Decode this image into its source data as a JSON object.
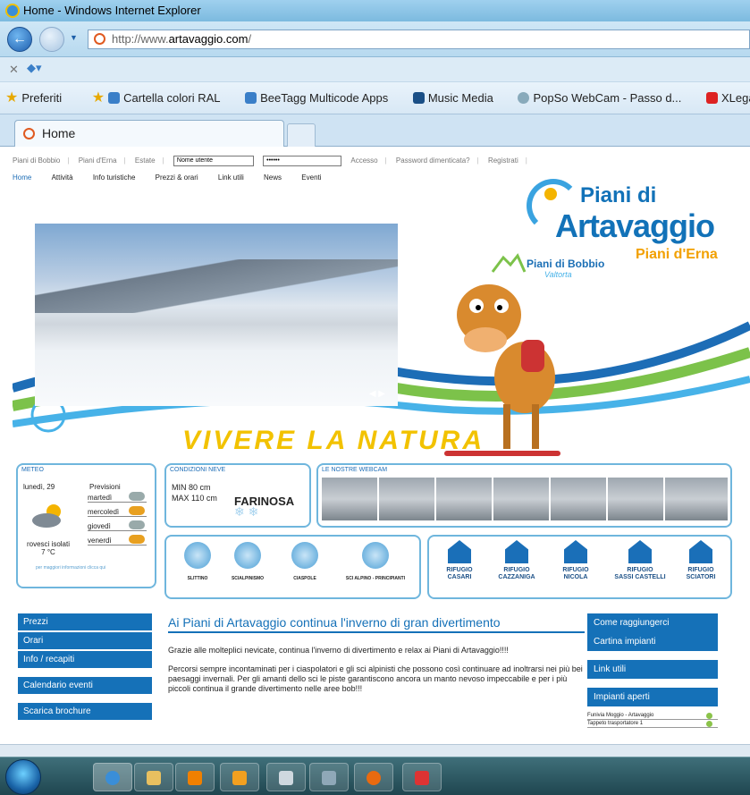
{
  "window": {
    "title": "Home - Windows Internet Explorer",
    "url_prefix": "http://www.",
    "url_domain": "artavaggio.com",
    "url_suffix": "/"
  },
  "favorites": [
    "Preferiti",
    "Cartella colori RAL",
    "BeeTagg Multicode Apps",
    "Music Media",
    "PopSo WebCam - Passo d...",
    "XLegalmail"
  ],
  "tab": {
    "title": "Home"
  },
  "site": {
    "topnav": [
      "Piani di Bobbio",
      "Piani d'Erna",
      "Estate"
    ],
    "login_user": "Nome utente",
    "login_pass": "••••••",
    "accesso": "Accesso",
    "password_forgot": "Password dimenticata?",
    "register": "Registrati",
    "mainnav": [
      "Home",
      "Attività",
      "Info turistiche",
      "Prezzi & orari",
      "Link utili",
      "News",
      "Eventi"
    ],
    "logo_line1": "Piani di",
    "logo_line2": "Artavaggio",
    "bobbio": "Piani di Bobbio",
    "bobbio_sub": "Valtorta",
    "erna": "Piani d'Erna",
    "slogan": "VIVERE LA NATURA",
    "meteo": {
      "title": "METEO",
      "today": "lunedì, 29",
      "prev": "Previsioni",
      "days": [
        "martedì",
        "mercoledì",
        "giovedì",
        "venerdì"
      ],
      "desc": "rovesci isolati",
      "temp": "7 °C",
      "link": "per maggiori informazioni clicca qui"
    },
    "neve": {
      "title": "CONDIZIONI NEVE",
      "min": "MIN 80 cm",
      "max": "MAX 110 cm",
      "type": "FARINOSA"
    },
    "webcam_title": "LE NOSTRE WEBCAM",
    "sports": [
      "SLITTINO",
      "SCIALPINISMO",
      "CIASPOLE",
      "SCI ALPINO - PRINCIPIANTI"
    ],
    "rifugi": [
      [
        "RIFUGIO",
        "CASARI"
      ],
      [
        "RIFUGIO",
        "CAZZANIGA"
      ],
      [
        "RIFUGIO",
        "NICOLA"
      ],
      [
        "RIFUGIO",
        "SASSI CASTELLI"
      ],
      [
        "RIFUGIO",
        "SCIATORI"
      ]
    ],
    "left": [
      "Prezzi",
      "Orari",
      "Info / recapiti",
      "Calendario eventi",
      "Scarica brochure"
    ],
    "article": {
      "title": "Ai Piani di Artavaggio continua l'inverno di gran divertimento",
      "p1": "Grazie alle molteplici nevicate, continua l'inverno di divertimento e relax ai Piani di Artavaggio!!!!",
      "p2": "Percorsi sempre incontaminati per i ciaspolatori e gli sci alpinisti che possono così continuare ad inoltrarsi nei più bei paesaggi invernali. Per gli amanti dello sci le piste garantiscono ancora un manto nevoso impeccabile e per i più piccoli continua il grande divertimento nelle aree bob!!!"
    },
    "right": [
      "Come raggiungerci",
      "Cartina impianti",
      "Link utili",
      "Impianti aperti"
    ],
    "impianti": [
      "Funivia Moggio - Artavaggio",
      "Tappeto trasportatore 1"
    ]
  }
}
